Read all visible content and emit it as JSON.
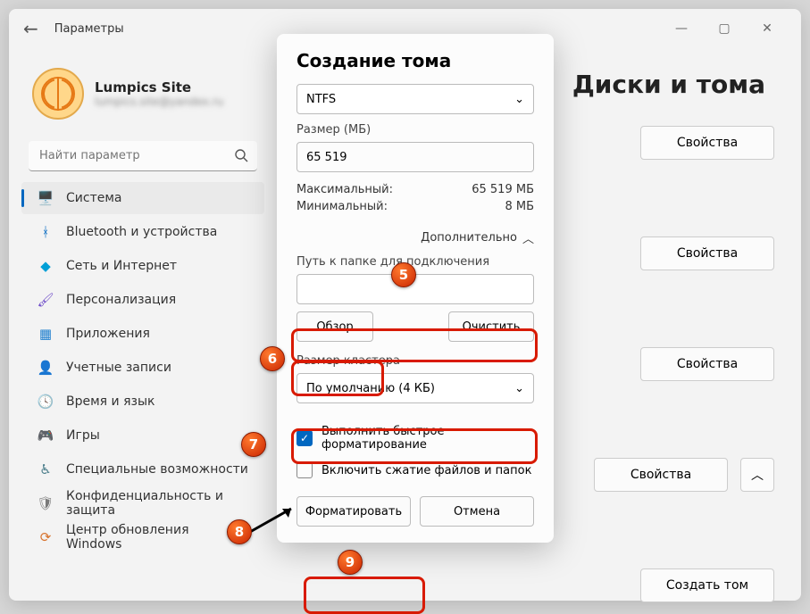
{
  "window": {
    "title": "Параметры"
  },
  "profile": {
    "name": "Lumpics Site",
    "email": "lumpics.site@yandex.ru"
  },
  "search": {
    "placeholder": "Найти параметр"
  },
  "sidebar": {
    "items": [
      {
        "label": "Система",
        "icon": "🖥️",
        "cls": "ic-sys",
        "active": true
      },
      {
        "label": "Bluetooth и устройства",
        "icon": "ᚼ",
        "cls": "ic-blue"
      },
      {
        "label": "Сеть и Интернет",
        "icon": "◆",
        "cls": "ic-teal"
      },
      {
        "label": "Персонализация",
        "icon": "🖌",
        "cls": "ic-brush"
      },
      {
        "label": "Приложения",
        "icon": "▦",
        "cls": "ic-apps"
      },
      {
        "label": "Учетные записи",
        "icon": "👤",
        "cls": "ic-acct"
      },
      {
        "label": "Время и язык",
        "icon": "🕓",
        "cls": "ic-time"
      },
      {
        "label": "Игры",
        "icon": "🎮",
        "cls": "ic-game"
      },
      {
        "label": "Специальные возможности",
        "icon": "♿",
        "cls": "ic-acc"
      },
      {
        "label": "Конфиденциальность и защита",
        "icon": "🛡",
        "cls": "ic-priv"
      },
      {
        "label": "Центр обновления Windows",
        "icon": "⟳",
        "cls": "ic-upd"
      }
    ]
  },
  "page": {
    "title": "Диски и тома",
    "btn_props": "Свойства",
    "btn_create": "Создать том"
  },
  "modal": {
    "title": "Создание тома",
    "fs_value": "NTFS",
    "size_label": "Размер (МБ)",
    "size_value": "65 519",
    "max_label": "Максимальный:",
    "max_value": "65 519 МБ",
    "min_label": "Минимальный:",
    "min_value": "8 МБ",
    "adv_label": "Дополнительно",
    "path_label": "Путь к папке для подключения",
    "browse": "Обзор",
    "clear": "Очистить",
    "cluster_label": "Размер кластера",
    "cluster_value": "По умолчанию (4 КБ)",
    "quick_format": "Выполнить быстрое форматирование",
    "compression": "Включить сжатие файлов и папок",
    "format": "Форматировать",
    "cancel": "Отмена"
  },
  "annotations": {
    "labels": {
      "5": "5",
      "6": "6",
      "7": "7",
      "8": "8",
      "9": "9"
    }
  }
}
